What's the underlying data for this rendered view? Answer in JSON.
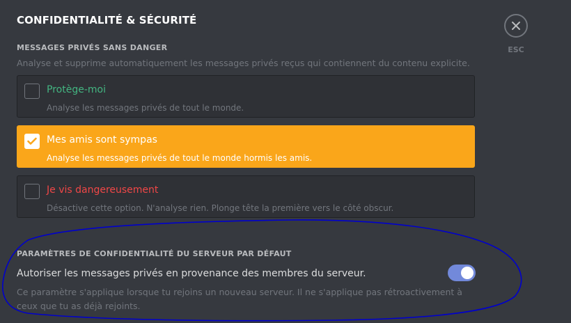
{
  "header": {
    "title": "CONFIDENTIALITÉ & SÉCURITÉ",
    "close_label": "ESC"
  },
  "safe_dm": {
    "title": "MESSAGES PRIVÉS SANS DANGER",
    "description": "Analyse et supprime automatiquement les messages privés reçus qui contiennent du contenu explicite.",
    "options": [
      {
        "title": "Protège-moi",
        "description": "Analyse les messages privés de tout le monde.",
        "checked": false,
        "color": "#43b581"
      },
      {
        "title": "Mes amis sont sympas",
        "description": "Analyse les messages privés de tout le monde hormis les amis.",
        "checked": true,
        "color": "#ffffff"
      },
      {
        "title": "Je vis dangereusement",
        "description": "Désactive cette option. N'analyse rien. Plonge tête la première vers le côté obscur.",
        "checked": false,
        "color": "#f04747"
      }
    ]
  },
  "server_privacy": {
    "title": "PARAMÈTRES DE CONFIDENTIALITÉ DU SERVEUR PAR DÉFAUT",
    "toggle_label": "Autoriser les messages privés en provenance des membres du serveur.",
    "toggle_on": true,
    "description": "Ce paramètre s'applique lorsque tu rejoins un nouveau serveur. Il ne s'applique pas rétroactivement à ceux que tu as déjà rejoints."
  },
  "colors": {
    "background": "#36393f",
    "selected": "#faa61a",
    "toggle_on": "#7289da",
    "annotation": "#0000cc"
  }
}
